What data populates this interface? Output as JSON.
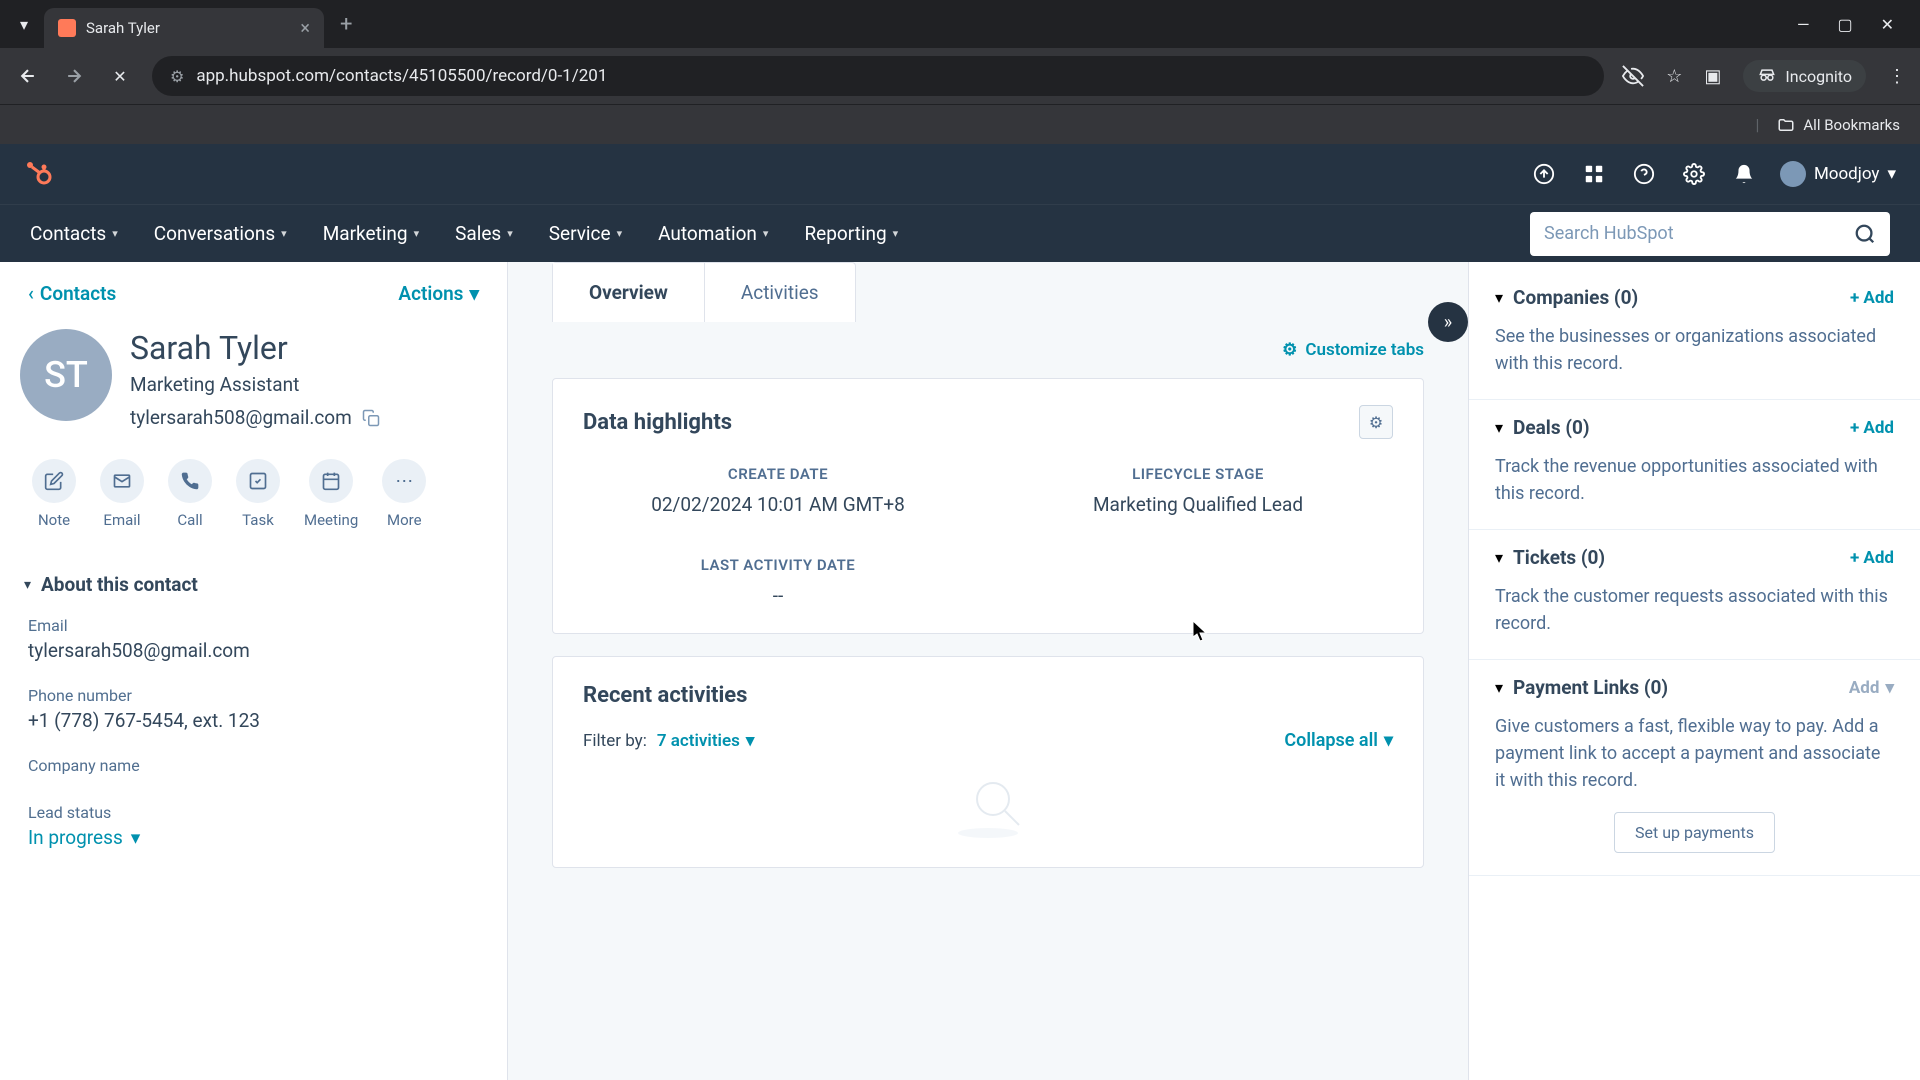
{
  "browser": {
    "tab_title": "Sarah Tyler",
    "url": "app.hubspot.com/contacts/45105500/record/0-1/201",
    "incognito": "Incognito",
    "all_bookmarks": "All Bookmarks"
  },
  "header": {
    "user_name": "Moodjoy",
    "search_placeholder": "Search HubSpot"
  },
  "nav": {
    "items": [
      "Contacts",
      "Conversations",
      "Marketing",
      "Sales",
      "Service",
      "Automation",
      "Reporting"
    ]
  },
  "left": {
    "back": "Contacts",
    "actions": "Actions",
    "avatar_initials": "ST",
    "name": "Sarah Tyler",
    "role": "Marketing Assistant",
    "email": "tylersarah508@gmail.com",
    "actions_row": [
      {
        "label": "Note"
      },
      {
        "label": "Email"
      },
      {
        "label": "Call"
      },
      {
        "label": "Task"
      },
      {
        "label": "Meeting"
      },
      {
        "label": "More"
      }
    ],
    "about_header": "About this contact",
    "fields": {
      "email_label": "Email",
      "email_value": "tylersarah508@gmail.com",
      "phone_label": "Phone number",
      "phone_value": "+1 (778) 767-5454, ext. 123",
      "company_label": "Company name",
      "company_value": "",
      "lead_label": "Lead status",
      "lead_value": "In progress"
    }
  },
  "main": {
    "tabs": {
      "overview": "Overview",
      "activities": "Activities"
    },
    "customize": "Customize tabs",
    "highlights": {
      "title": "Data highlights",
      "create_label": "CREATE DATE",
      "create_value": "02/02/2024 10:01 AM GMT+8",
      "lifecycle_label": "LIFECYCLE STAGE",
      "lifecycle_value": "Marketing Qualified Lead",
      "last_label": "LAST ACTIVITY DATE",
      "last_value": "--"
    },
    "recent": {
      "title": "Recent activities",
      "filter_label": "Filter by:",
      "filter_value": "7 activities",
      "collapse": "Collapse all"
    }
  },
  "right": {
    "companies": {
      "title": "Companies (0)",
      "add": "+ Add",
      "desc": "See the businesses or organizations associated with this record."
    },
    "deals": {
      "title": "Deals (0)",
      "add": "+ Add",
      "desc": "Track the revenue opportunities associated with this record."
    },
    "tickets": {
      "title": "Tickets (0)",
      "add": "+ Add",
      "desc": "Track the customer requests associated with this record."
    },
    "payments": {
      "title": "Payment Links (0)",
      "add": "Add",
      "desc": "Give customers a fast, flexible way to pay. Add a payment link to accept a payment and associate it with this record.",
      "setup": "Set up payments"
    }
  }
}
